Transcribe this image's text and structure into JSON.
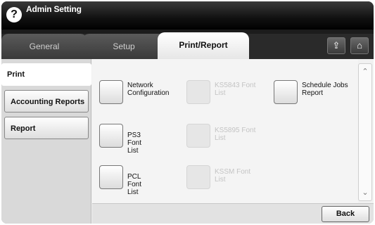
{
  "header": {
    "title": "Admin Setting",
    "help_icon": "?"
  },
  "tabs": [
    {
      "label": "General",
      "active": false
    },
    {
      "label": "Setup",
      "active": false
    },
    {
      "label": "Print/Report",
      "active": true
    }
  ],
  "tab_icons": [
    {
      "name": "job-status-icon",
      "glyph": "⇪"
    },
    {
      "name": "home-icon",
      "glyph": "⌂"
    }
  ],
  "sidebar": {
    "items": [
      {
        "label": "Print",
        "selected": true
      },
      {
        "label": "Accounting Reports",
        "selected": false
      },
      {
        "label": "Report",
        "selected": false
      }
    ]
  },
  "options": {
    "network_configuration": "Network\nConfiguration",
    "ks5843_font_list": "KS5843 Font\nList",
    "schedule_jobs_report": "Schedule Jobs\nReport",
    "ps3_font_list": "PS3 Font List",
    "ks5895_font_list": "KS5895 Font\nList",
    "pcl_font_list": "PCL Font List",
    "kssm_font_list": "KSSM Font\nList"
  },
  "scrollbar": {
    "up": "⌃",
    "down": "⌄"
  },
  "footer": {
    "back_label": "Back"
  }
}
